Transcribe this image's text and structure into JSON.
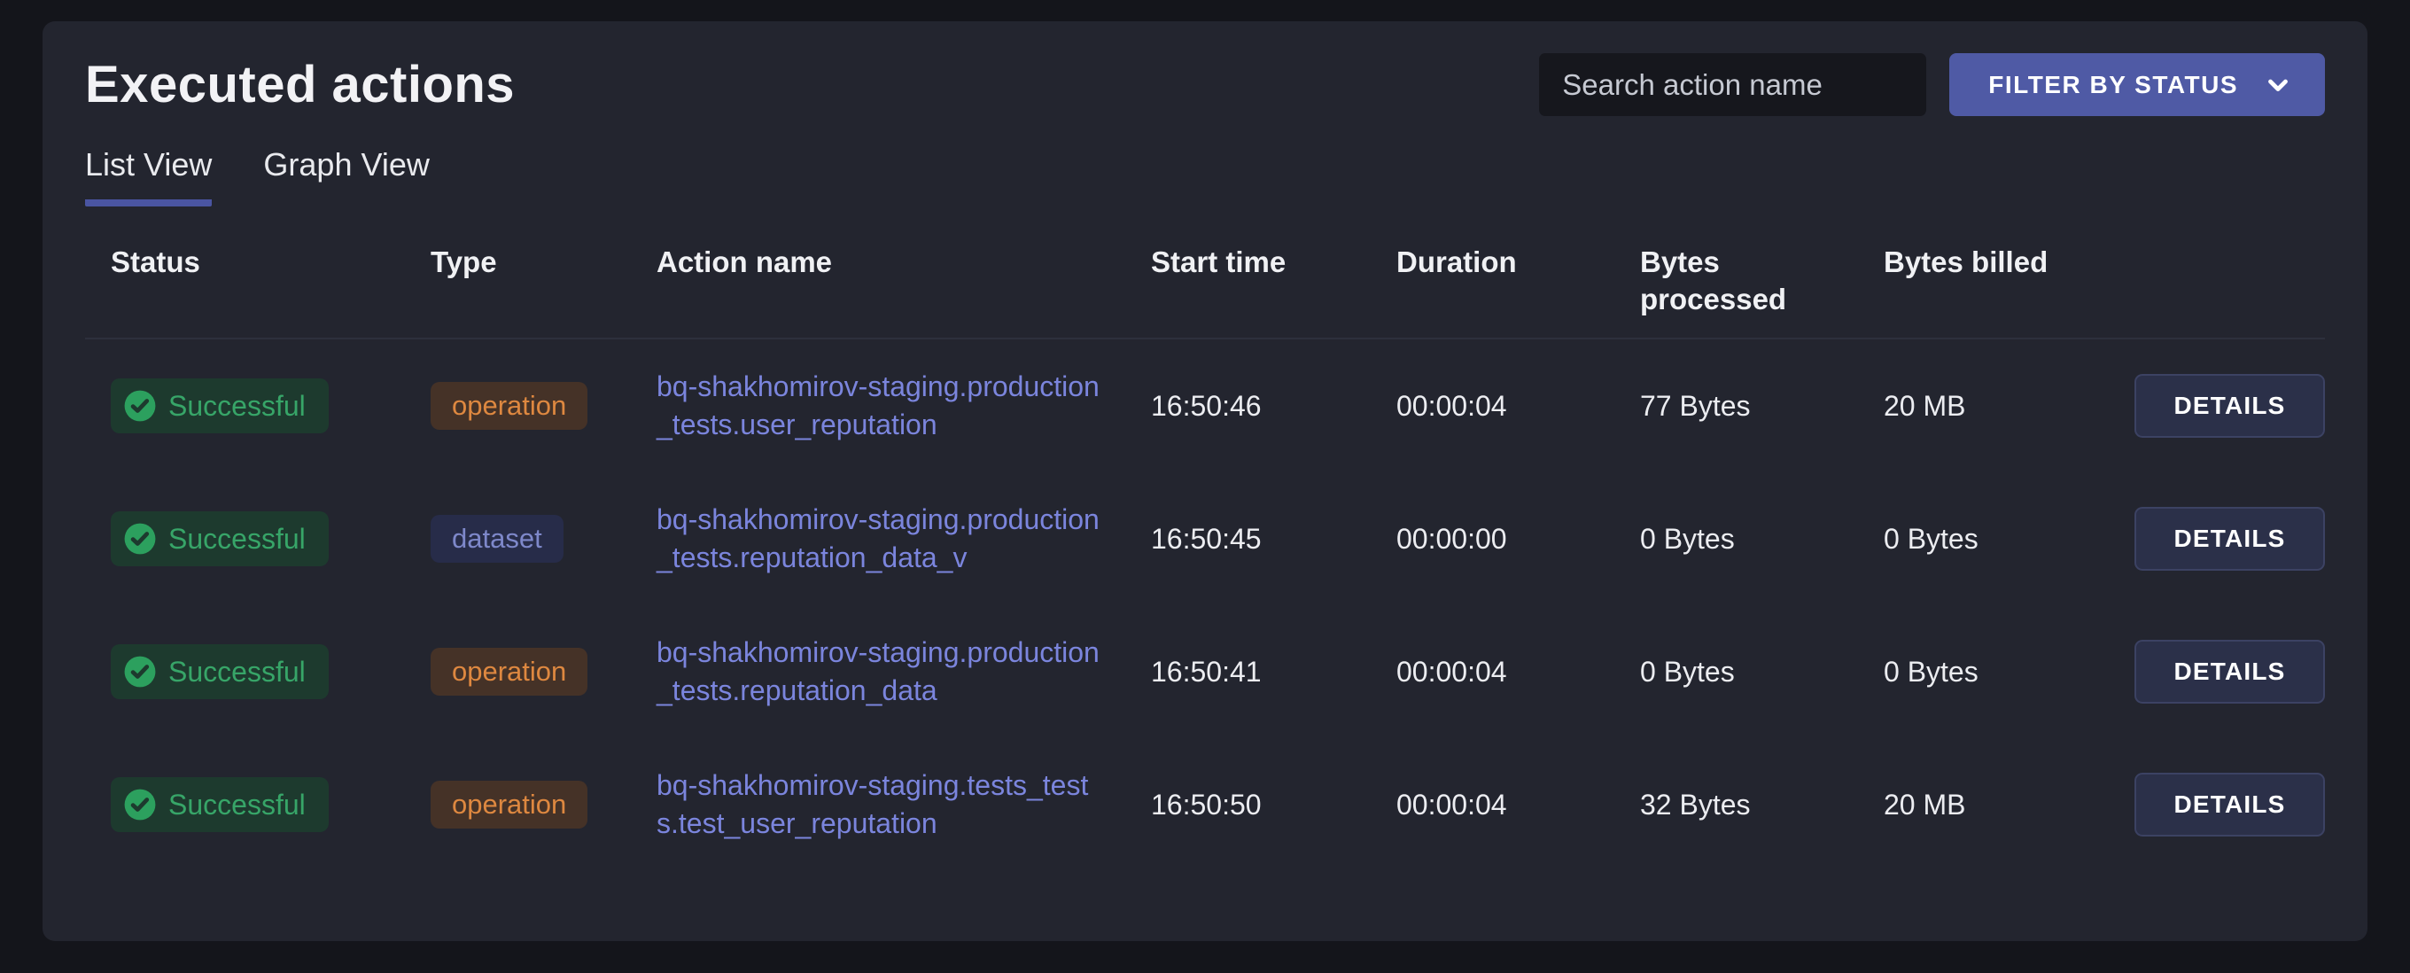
{
  "page": {
    "title": "Executed actions"
  },
  "search": {
    "placeholder": "Search action name"
  },
  "filter_button": {
    "label": "FILTER BY STATUS",
    "icon": "chevron-down-icon"
  },
  "tabs": [
    {
      "label": "List View",
      "active": true
    },
    {
      "label": "Graph View",
      "active": false
    }
  ],
  "table": {
    "columns": [
      "Status",
      "Type",
      "Action name",
      "Start time",
      "Duration",
      "Bytes processed",
      "Bytes billed"
    ],
    "rows": [
      {
        "status": "Successful",
        "status_icon": "check-circle-icon",
        "type": "operation",
        "action_name": "bq-shakhomirov-staging.production_tests.user_reputation",
        "start_time": "16:50:46",
        "duration": "00:00:04",
        "bytes_processed": "77 Bytes",
        "bytes_billed": "20 MB",
        "details_label": "DETAILS"
      },
      {
        "status": "Successful",
        "status_icon": "check-circle-icon",
        "type": "dataset",
        "action_name": "bq-shakhomirov-staging.production_tests.reputation_data_v",
        "start_time": "16:50:45",
        "duration": "00:00:00",
        "bytes_processed": "0 Bytes",
        "bytes_billed": "0 Bytes",
        "details_label": "DETAILS"
      },
      {
        "status": "Successful",
        "status_icon": "check-circle-icon",
        "type": "operation",
        "action_name": "bq-shakhomirov-staging.production_tests.reputation_data",
        "start_time": "16:50:41",
        "duration": "00:00:04",
        "bytes_processed": "0 Bytes",
        "bytes_billed": "0 Bytes",
        "details_label": "DETAILS"
      },
      {
        "status": "Successful",
        "status_icon": "check-circle-icon",
        "type": "operation",
        "action_name": "bq-shakhomirov-staging.tests_tests.test_user_reputation",
        "start_time": "16:50:50",
        "duration": "00:00:04",
        "bytes_processed": "32 Bytes",
        "bytes_billed": "20 MB",
        "details_label": "DETAILS"
      }
    ]
  },
  "colors": {
    "page_background": "#14151b",
    "card_background": "#23252f",
    "accent_indigo": "#4f5aa5",
    "tab_underline": "#4a55a2",
    "link": "#7b85dd",
    "success_text": "#37a568",
    "success_badge_bg": "#1d3a2e",
    "success_icon_circle": "#2ca05e",
    "operation_text": "#de8840",
    "operation_badge_bg": "#453227",
    "dataset_text": "#7e88ca",
    "dataset_badge_bg": "#272c49",
    "details_button_bg": "#2b3049"
  }
}
